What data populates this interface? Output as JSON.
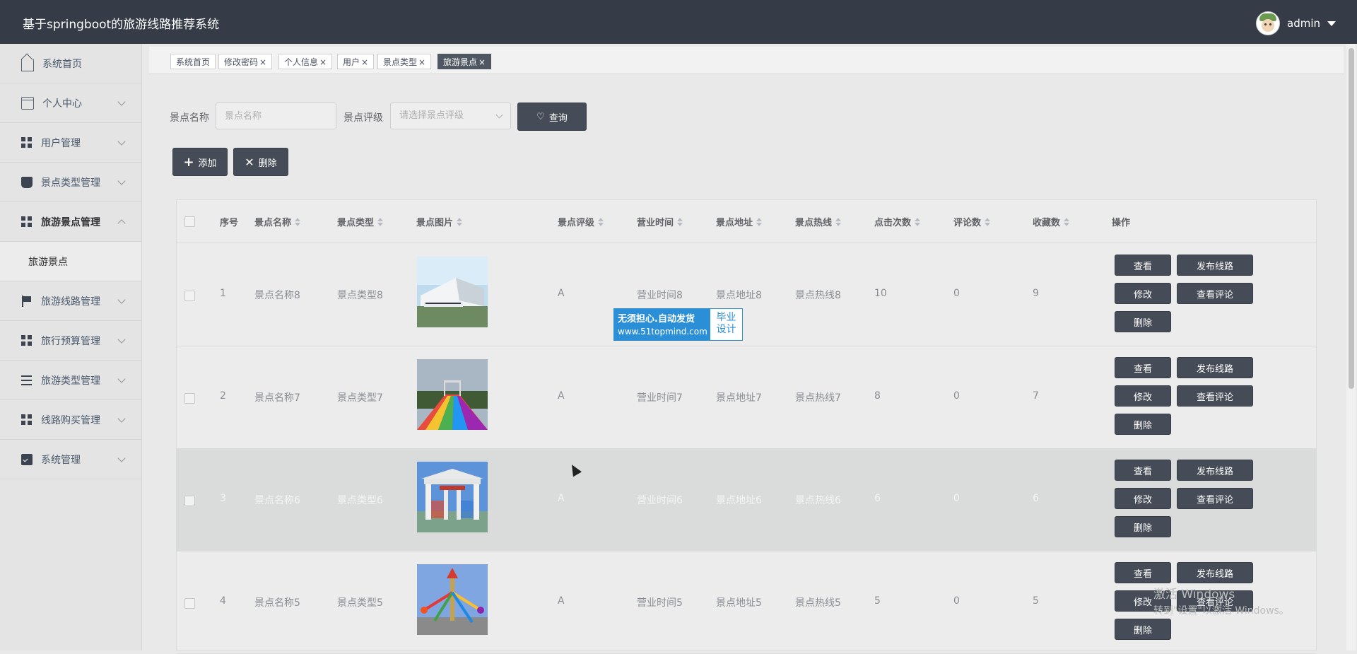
{
  "header": {
    "app_title": "基于springboot的旅游线路推荐系统",
    "username": "admin"
  },
  "sidebar": {
    "items": [
      {
        "label": "系统首页",
        "icon": "home-icon"
      },
      {
        "label": "个人中心",
        "icon": "card-icon"
      },
      {
        "label": "用户管理",
        "icon": "grid-icon"
      },
      {
        "label": "景点类型管理",
        "icon": "cup-icon"
      },
      {
        "label": "旅游景点管理",
        "icon": "grid-icon"
      },
      {
        "label": "旅游线路管理",
        "icon": "flag-icon"
      },
      {
        "label": "旅行预算管理",
        "icon": "grid-icon"
      },
      {
        "label": "旅游类型管理",
        "icon": "list-icon"
      },
      {
        "label": "线路购买管理",
        "icon": "grid-icon"
      },
      {
        "label": "系统管理",
        "icon": "clipboard-icon"
      }
    ],
    "submenu": {
      "label": "旅游景点"
    }
  },
  "tabs": [
    {
      "label": "系统首页",
      "close": ""
    },
    {
      "label": "修改密码",
      "close": "×"
    },
    {
      "label": "个人信息",
      "close": "×"
    },
    {
      "label": "用户",
      "close": "×"
    },
    {
      "label": "景点类型",
      "close": "×"
    },
    {
      "label": "旅游景点",
      "close": "×"
    }
  ],
  "search": {
    "name_label": "景点名称",
    "name_placeholder": "景点名称",
    "rating_label": "景点评级",
    "rating_placeholder": "请选择景点评级",
    "query_button": "查询"
  },
  "actions": {
    "add_button": "添加",
    "delete_button": "删除"
  },
  "table": {
    "columns": [
      "序号",
      "景点名称",
      "景点类型",
      "景点图片",
      "景点评级",
      "营业时间",
      "景点地址",
      "景点热线",
      "点击次数",
      "评论数",
      "收藏数",
      "操作"
    ],
    "rows": [
      {
        "index": "1",
        "name": "景点名称8",
        "type": "景点类型8",
        "rating": "A",
        "hours": "营业时间8",
        "address": "景点地址8",
        "hotline": "景点热线8",
        "clicks": "10",
        "comments": "0",
        "favorites": "9"
      },
      {
        "index": "2",
        "name": "景点名称7",
        "type": "景点类型7",
        "rating": "A",
        "hours": "营业时间7",
        "address": "景点地址7",
        "hotline": "景点热线7",
        "clicks": "8",
        "comments": "0",
        "favorites": "7"
      },
      {
        "index": "3",
        "name": "景点名称6",
        "type": "景点类型6",
        "rating": "A",
        "hours": "营业时间6",
        "address": "景点地址6",
        "hotline": "景点热线6",
        "clicks": "6",
        "comments": "0",
        "favorites": "6"
      },
      {
        "index": "4",
        "name": "景点名称5",
        "type": "景点类型5",
        "rating": "A",
        "hours": "营业时间5",
        "address": "景点地址5",
        "hotline": "景点热线5",
        "clicks": "5",
        "comments": "0",
        "favorites": "5"
      }
    ],
    "op_labels": {
      "view": "查看",
      "publish": "发布线路",
      "edit": "修改",
      "view_comments": "查看评论",
      "delete": "删除"
    }
  },
  "promo": {
    "line1": "无须担心.自动发货",
    "line2": "www.51topmind.com",
    "right1": "毕业",
    "right2": "设计"
  },
  "os_watermark": {
    "line1": "激活 Windows",
    "line2": "转到\"设置\"以激活 Windows。"
  },
  "colors": {
    "header_bg": "#353c47",
    "button_dark": "#454c57",
    "promo_blue": "#2a8fd6"
  }
}
